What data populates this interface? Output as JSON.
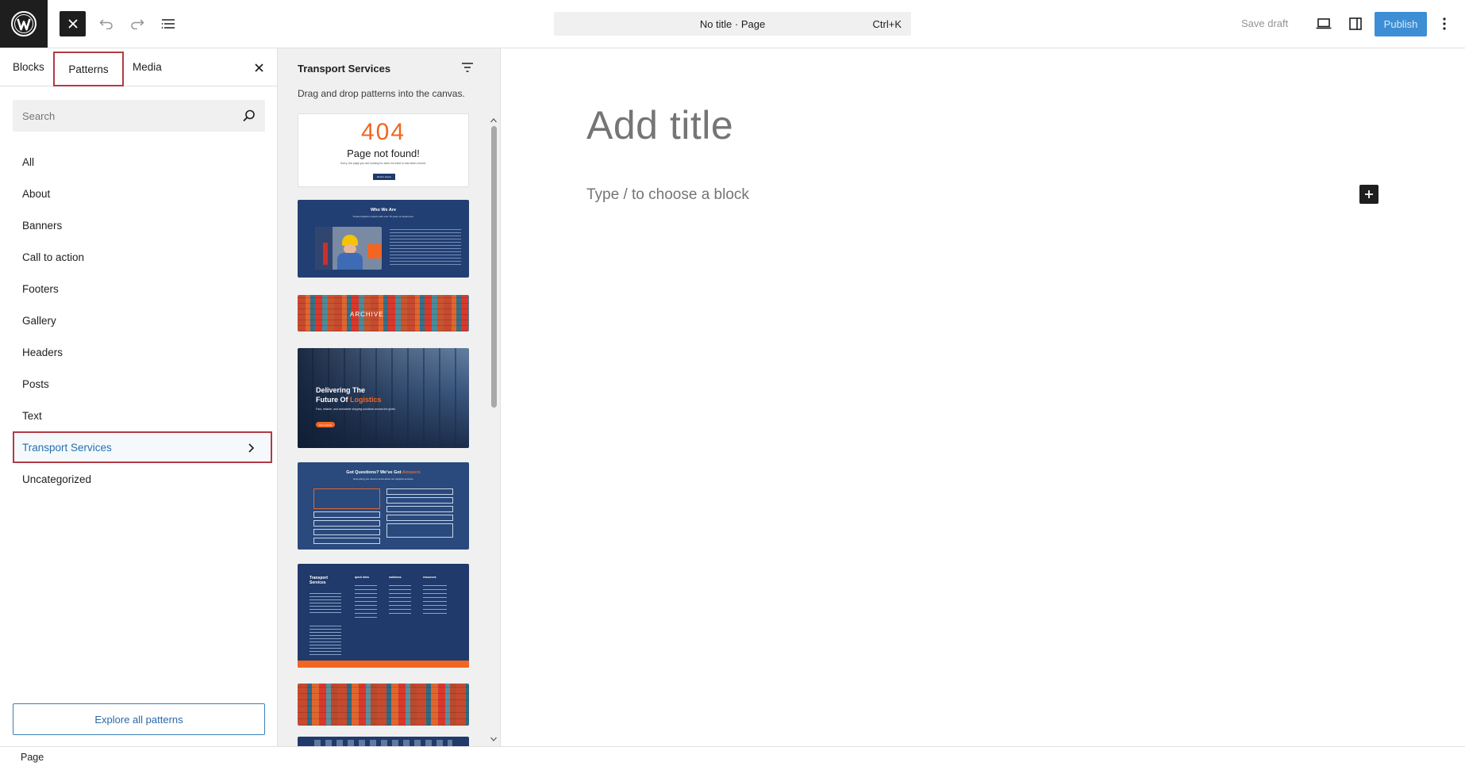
{
  "header": {
    "doc_title": "No title · Page",
    "shortcut": "Ctrl+K",
    "save_draft": "Save draft",
    "publish": "Publish"
  },
  "inserter": {
    "tabs": [
      {
        "label": "Blocks"
      },
      {
        "label": "Patterns"
      },
      {
        "label": "Media"
      }
    ],
    "search": {
      "placeholder": "Search",
      "value": ""
    },
    "categories": [
      {
        "label": "All"
      },
      {
        "label": "About"
      },
      {
        "label": "Banners"
      },
      {
        "label": "Call to action"
      },
      {
        "label": "Footers"
      },
      {
        "label": "Gallery"
      },
      {
        "label": "Headers"
      },
      {
        "label": "Posts"
      },
      {
        "label": "Text"
      },
      {
        "label": "Transport Services"
      },
      {
        "label": "Uncategorized"
      }
    ],
    "explore": "Explore all patterns"
  },
  "patterns": {
    "title": "Transport Services",
    "description": "Drag and drop patterns into the canvas.",
    "p404": {
      "number": "404",
      "heading": "Page not found!",
      "text": "Sorry, the page you are looking for does not exist or has been moved.",
      "button": "Return Home"
    },
    "who": {
      "heading": "Who We Are",
      "sub": "Trusted logistics experts with over 15 years of experience."
    },
    "banner": "ARCHIVE",
    "hero": {
      "line1": "Delivering The",
      "line2": "Future Of",
      "accent": "Logistics",
      "sub": "Fast, reliable, and worldwide shipping solutions across the globe.",
      "button": "Get a Quote"
    },
    "faq": {
      "heading": "Got Questions? We've Got",
      "accent": "Answers",
      "sub": "Everything you need to know about our logistics services"
    },
    "footer_pat": {
      "brand": "Transport Services",
      "col1": "quick links",
      "col2": "solutions",
      "col3": "resources"
    }
  },
  "canvas": {
    "title_placeholder": "Add title",
    "block_placeholder": "Type / to choose a block"
  },
  "footer": {
    "breadcrumb": "Page"
  },
  "colors": {
    "accent_red": "#b33a45",
    "publish_blue": "#3d8ed4",
    "link_blue": "#2271b1",
    "pattern_navy": "#1f3a6b",
    "pattern_orange": "#f26522"
  }
}
